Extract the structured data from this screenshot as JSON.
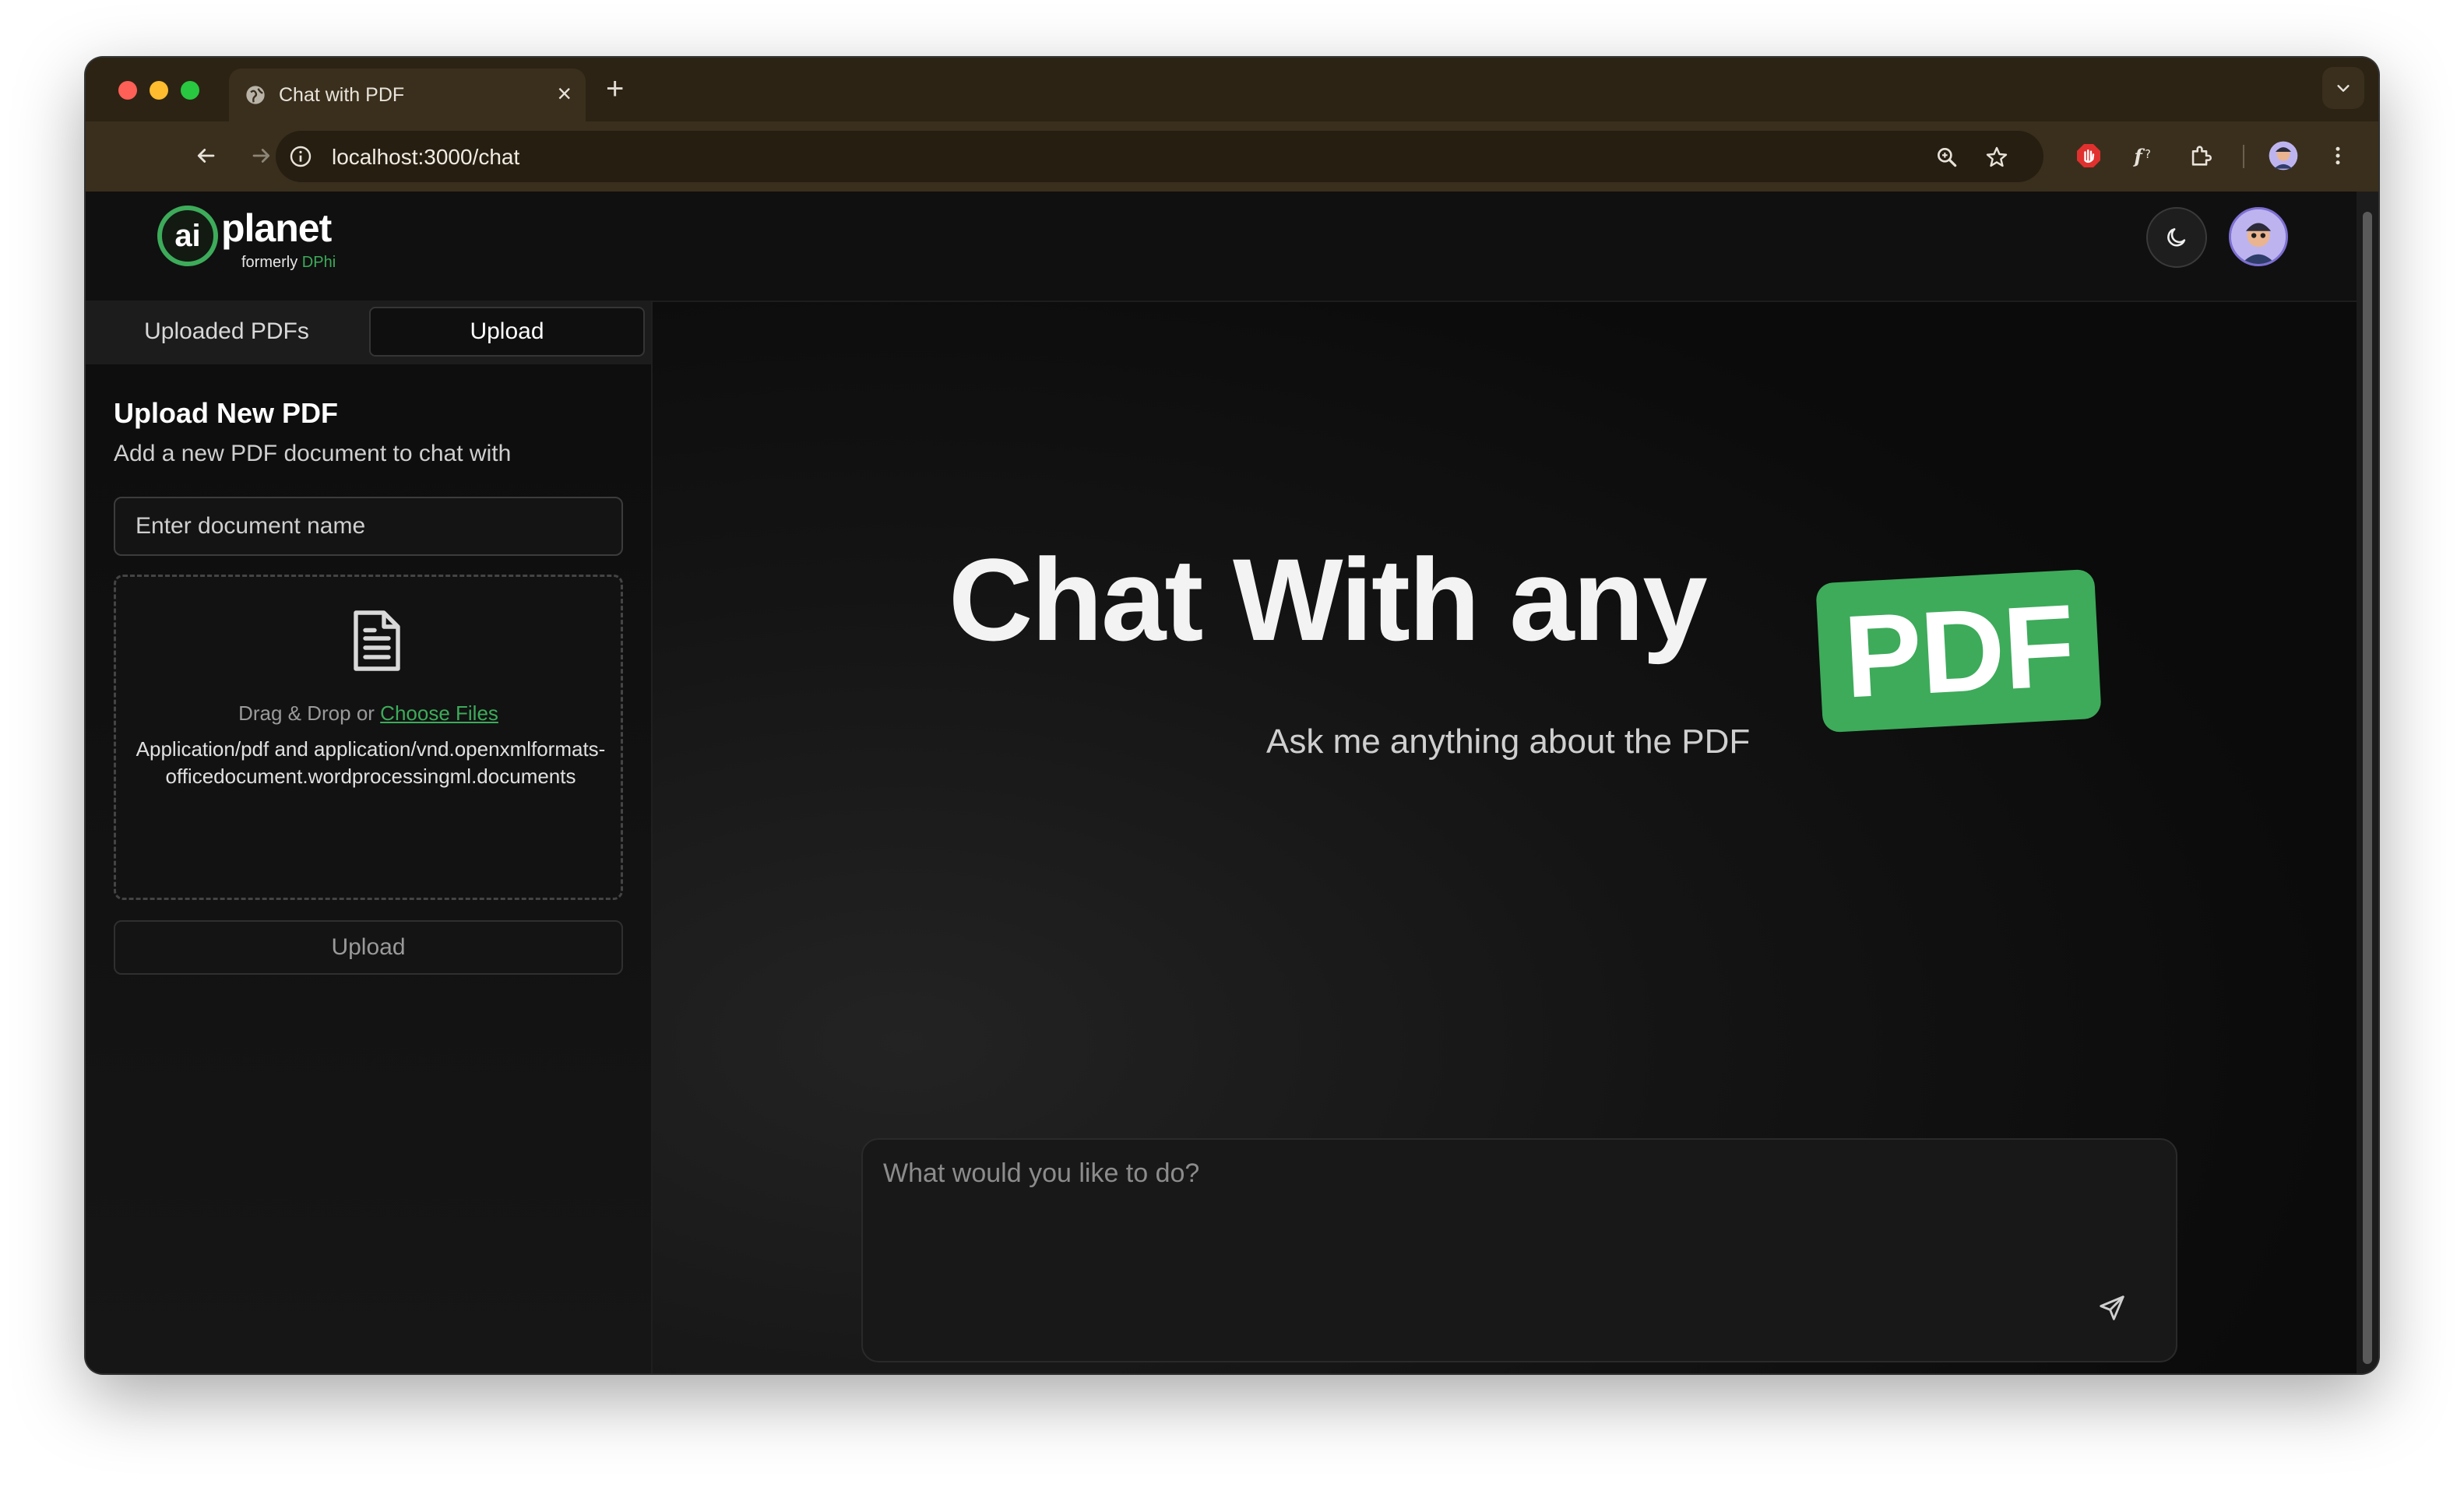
{
  "browser": {
    "tab_title": "Chat with PDF",
    "new_tab_label": "+",
    "url": "localhost:3000/chat"
  },
  "app": {
    "logo": {
      "mark": "ai",
      "word": "planet",
      "sub_prefix": "formerly",
      "sub_brand": "DPhi"
    },
    "sidebar": {
      "tabs": [
        "Uploaded PDFs",
        "Upload"
      ],
      "active_tab": "Upload",
      "upload_title": "Upload New PDF",
      "upload_desc": "Add a new PDF document to chat with",
      "doc_name_placeholder": "Enter document name",
      "dropzone": {
        "prefix": "Drag & Drop or",
        "link": "Choose Files",
        "types": "Application/pdf and application/vnd.openxmlformats-officedocument.wordprocessingml.documents"
      },
      "upload_button": "Upload"
    },
    "hero": {
      "title": "Chat With any",
      "badge": "PDF",
      "subtitle": "Ask me anything about the PDF"
    },
    "chat": {
      "placeholder": "What would you like to do?"
    }
  },
  "colors": {
    "accent": "#3dab5a",
    "browser_frame": "#3a2f1d",
    "page_bg": "#0e0e0e"
  },
  "icons": [
    "globe-icon",
    "close-icon",
    "chevron-down-icon",
    "back-arrow-icon",
    "forward-arrow-icon",
    "reload-icon",
    "info-icon",
    "zoom-icon",
    "star-icon",
    "adblock-icon",
    "function-ext-icon",
    "puzzle-icon",
    "profile-avatar-icon",
    "kebab-menu-icon",
    "moon-icon",
    "user-avatar-icon",
    "document-icon",
    "send-icon"
  ]
}
